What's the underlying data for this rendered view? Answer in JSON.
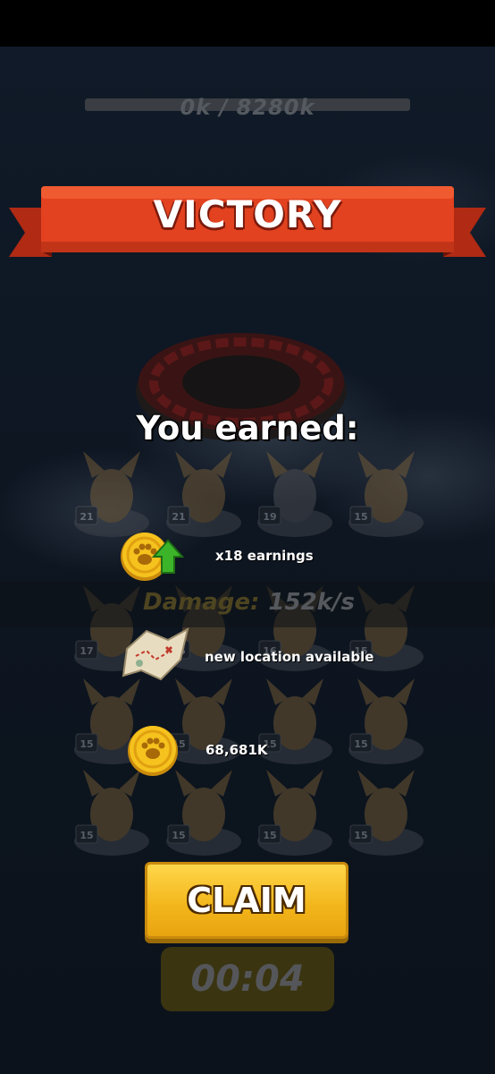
{
  "status_bar": {},
  "header": {
    "progress_text": "0k / 8280k"
  },
  "banner": {
    "title": "VICTORY"
  },
  "rewards": {
    "title": "You earned:",
    "items": [
      {
        "icon": "paw-coin-boost-icon",
        "label": "x18 earnings"
      },
      {
        "icon": "treasure-map-icon",
        "label": "new location available"
      },
      {
        "icon": "paw-coin-icon",
        "label": "68,681K"
      }
    ]
  },
  "damage": {
    "label": "Damage:",
    "value": "152k/s"
  },
  "units": {
    "row1": [
      "21",
      "21",
      "19",
      "15"
    ],
    "row2": [
      "17",
      "16",
      "16",
      "15"
    ],
    "row3": [
      "15",
      "15",
      "15",
      "15"
    ],
    "row4": [
      "15",
      "15",
      "15",
      "15"
    ]
  },
  "actions": {
    "claim_label": "CLAIM"
  },
  "timer": {
    "value": "00:04"
  },
  "colors": {
    "ribbon": "#e2421f",
    "claim": "#f4bd24",
    "coin": "#f5c21e"
  }
}
